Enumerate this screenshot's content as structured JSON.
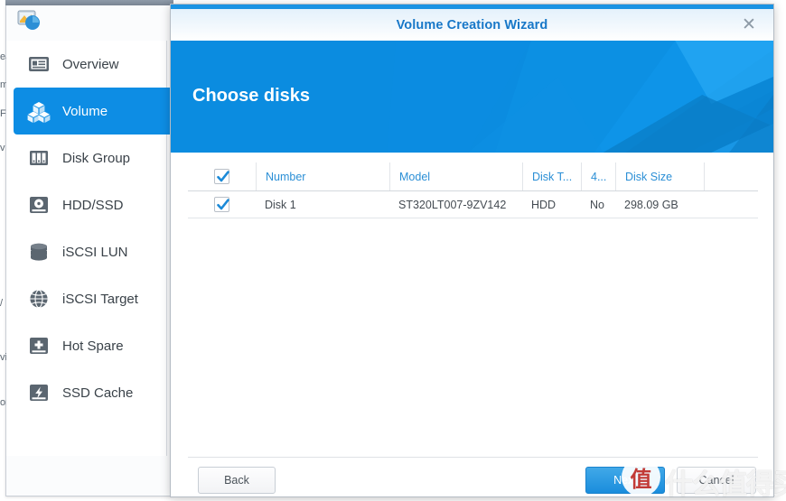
{
  "app": {
    "logo_icon": "storage-manager-icon"
  },
  "sidebar": {
    "items": [
      {
        "label": "Overview",
        "icon": "id-card-icon",
        "active": false
      },
      {
        "label": "Volume",
        "icon": "cubes-icon",
        "active": true
      },
      {
        "label": "Disk Group",
        "icon": "disk-group-icon",
        "active": false
      },
      {
        "label": "HDD/SSD",
        "icon": "hard-disk-icon",
        "active": false
      },
      {
        "label": "iSCSI LUN",
        "icon": "database-icon",
        "active": false
      },
      {
        "label": "iSCSI Target",
        "icon": "globe-icon",
        "active": false
      },
      {
        "label": "Hot Spare",
        "icon": "hot-spare-icon",
        "active": false
      },
      {
        "label": "SSD Cache",
        "icon": "ssd-cache-icon",
        "active": false
      }
    ]
  },
  "edge_fragments": [
    "ea",
    "m",
    "F",
    "v",
    "/",
    "vi",
    "on"
  ],
  "dialog": {
    "title": "Volume Creation Wizard",
    "close_icon": "close-icon",
    "banner": {
      "heading": "Choose disks",
      "color": "#0b8ce0"
    },
    "table": {
      "select_all_checked": true,
      "columns": [
        {
          "key": "check",
          "label": ""
        },
        {
          "key": "number",
          "label": "Number"
        },
        {
          "key": "model",
          "label": "Model"
        },
        {
          "key": "type",
          "label": "Disk T..."
        },
        {
          "key": "k4",
          "label": "4..."
        },
        {
          "key": "size",
          "label": "Disk Size"
        }
      ],
      "rows": [
        {
          "checked": true,
          "number": "Disk 1",
          "model": "ST320LT007-9ZV142",
          "type": "HDD",
          "k4": "No",
          "size": "298.09 GB"
        }
      ]
    },
    "buttons": {
      "back": "Back",
      "next": "Next",
      "cancel": "Cancel"
    }
  },
  "watermark": {
    "badge": "值",
    "text": "什么值得买"
  },
  "colors": {
    "accent": "#0d8de4",
    "title_text": "#1878c8",
    "header_link": "#2b8fd6"
  }
}
